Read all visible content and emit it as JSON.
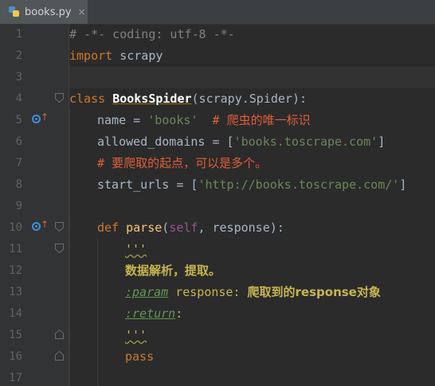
{
  "tab": {
    "filename": "books.py",
    "close": "×",
    "icon": "python-file-icon"
  },
  "line_numbers": [
    "1",
    "2",
    "3",
    "4",
    "5",
    "6",
    "7",
    "8",
    "9",
    "10",
    "11",
    "12",
    "13",
    "14",
    "15",
    "16",
    "17"
  ],
  "code": {
    "l1": "# -*- coding: utf-8 -*-",
    "l2_kw": "import",
    "l2_rest": " scrapy",
    "l4_kw": "class",
    "l4_name": "BooksSpider",
    "l4_rest": "(scrapy.Spider):",
    "l5_a": "name = ",
    "l5_str": "'books'",
    "l5_hash": "  # ",
    "l5_cmt": "爬虫的唯一标识",
    "l6_a": "allowed_domains = [",
    "l6_str": "'books.toscrape.com'",
    "l6_b": "]",
    "l7_hash": "# ",
    "l7_cmt": "要爬取的起点，可以是多个。",
    "l8_a": "start_urls = [",
    "l8_str": "'http://books.toscrape.com/'",
    "l8_b": "]",
    "l10_kw": "def",
    "l10_fn": "parse",
    "l10_open": "(",
    "l10_self": "self",
    "l10_rest": ", response):",
    "l11": "'''",
    "l12": "数据解析，提取。",
    "l13_tag": ":param",
    "l13_a": " response: ",
    "l13_b": "爬取到的response对象",
    "l14_tag": ":return",
    "l14_b": ":",
    "l15": "'''",
    "l16": "pass"
  },
  "colors": {
    "background": "#2b2b2b",
    "gutter": "#313335",
    "keyword": "#cc7832",
    "string": "#6a8759",
    "docstring": "#c8b550",
    "comment": "#808080",
    "comment_cn": "#e05f38",
    "self": "#94558d",
    "function": "#ffc66d",
    "override_marker": "#3f8fd8"
  }
}
